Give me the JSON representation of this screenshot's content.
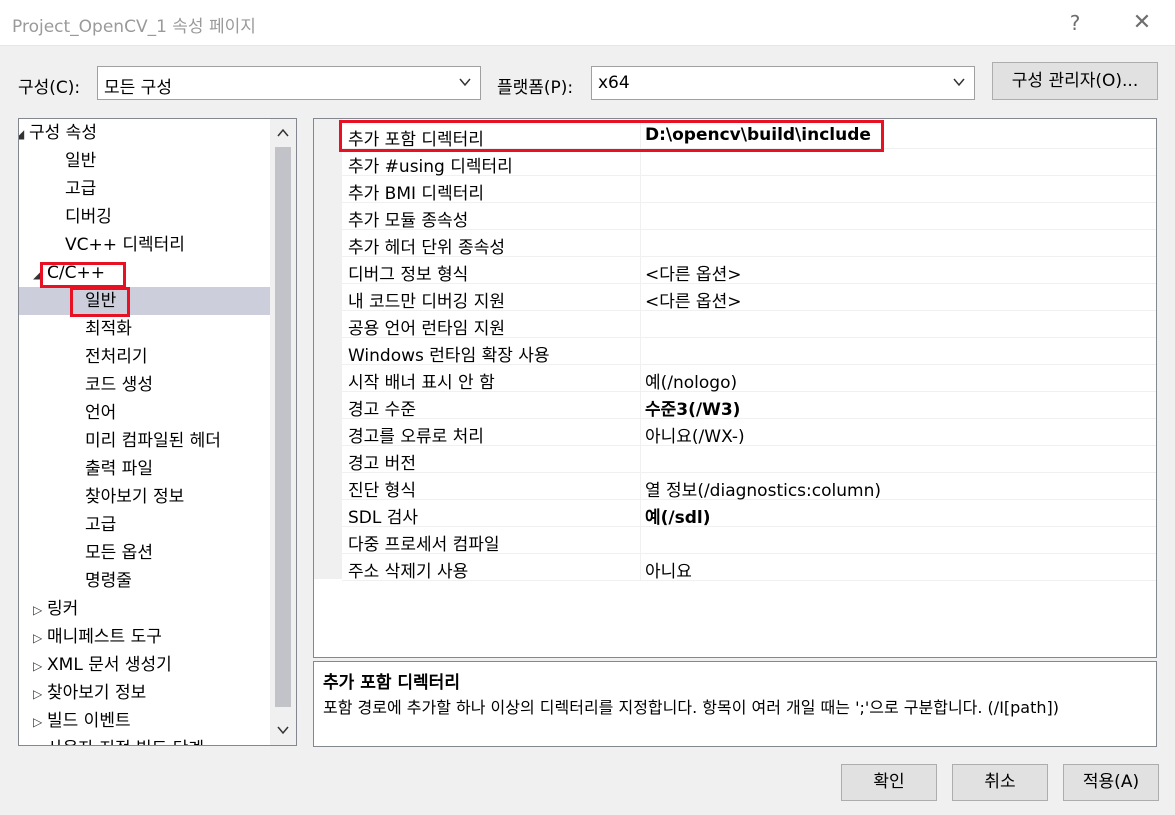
{
  "window": {
    "title": "Project_OpenCV_1 속성 페이지",
    "help_label": "?",
    "close_label": "✕"
  },
  "config": {
    "label": "구성(C):",
    "value": "모든 구성",
    "platform_label": "플랫폼(P):",
    "platform_value": "x64",
    "manager_button": "구성 관리자(O)..."
  },
  "tree": {
    "items": [
      {
        "label": "구성 속성",
        "toggle": "◢"
      },
      {
        "label": "일반"
      },
      {
        "label": "고급"
      },
      {
        "label": "디버깅"
      },
      {
        "label": "VC++ 디렉터리"
      },
      {
        "label": "C/C++",
        "toggle": "◢"
      },
      {
        "label": "일반"
      },
      {
        "label": "최적화"
      },
      {
        "label": "전처리기"
      },
      {
        "label": "코드 생성"
      },
      {
        "label": "언어"
      },
      {
        "label": "미리 컴파일된 헤더"
      },
      {
        "label": "출력 파일"
      },
      {
        "label": "찾아보기 정보"
      },
      {
        "label": "고급"
      },
      {
        "label": "모든 옵션"
      },
      {
        "label": "명령줄"
      },
      {
        "label": "링커",
        "toggle": "▷"
      },
      {
        "label": "매니페스트 도구",
        "toggle": "▷"
      },
      {
        "label": "XML 문서 생성기",
        "toggle": "▷"
      },
      {
        "label": "찾아보기 정보",
        "toggle": "▷"
      },
      {
        "label": "빌드 이벤트",
        "toggle": "▷"
      },
      {
        "label": "사용자 지정 빌드 단계",
        "toggle": "▷"
      }
    ]
  },
  "properties": [
    {
      "name": "추가 포함 디렉터리",
      "value": "D:\\opencv\\build\\include",
      "bold": true
    },
    {
      "name": "추가 #using 디렉터리",
      "value": ""
    },
    {
      "name": "추가 BMI 디렉터리",
      "value": ""
    },
    {
      "name": "추가 모듈 종속성",
      "value": ""
    },
    {
      "name": "추가 헤더 단위 종속성",
      "value": ""
    },
    {
      "name": "디버그 정보 형식",
      "value": "<다른 옵션>"
    },
    {
      "name": "내 코드만 디버깅 지원",
      "value": "<다른 옵션>"
    },
    {
      "name": "공용 언어 런타임 지원",
      "value": ""
    },
    {
      "name": "Windows 런타임 확장 사용",
      "value": ""
    },
    {
      "name": "시작 배너 표시 안 함",
      "value": "예(/nologo)"
    },
    {
      "name": "경고 수준",
      "value": "수준3(/W3)",
      "bold": true
    },
    {
      "name": "경고를 오류로 처리",
      "value": "아니요(/WX-)"
    },
    {
      "name": "경고 버전",
      "value": ""
    },
    {
      "name": "진단 형식",
      "value": "열 정보(/diagnostics:column)"
    },
    {
      "name": "SDL 검사",
      "value": "예(/sdl)",
      "bold": true
    },
    {
      "name": "다중 프로세서 컴파일",
      "value": ""
    },
    {
      "name": "주소 삭제기 사용",
      "value": "아니요"
    }
  ],
  "description": {
    "title": "추가 포함 디렉터리",
    "text": "포함 경로에 추가할 하나 이상의 디렉터리를 지정합니다. 항목이 여러 개일 때는 ';'으로 구분합니다. (/I[path])"
  },
  "buttons": {
    "ok": "확인",
    "cancel": "취소",
    "apply": "적용(A)"
  },
  "colors": {
    "highlight": "#e81123",
    "selection": "#cccedb"
  }
}
